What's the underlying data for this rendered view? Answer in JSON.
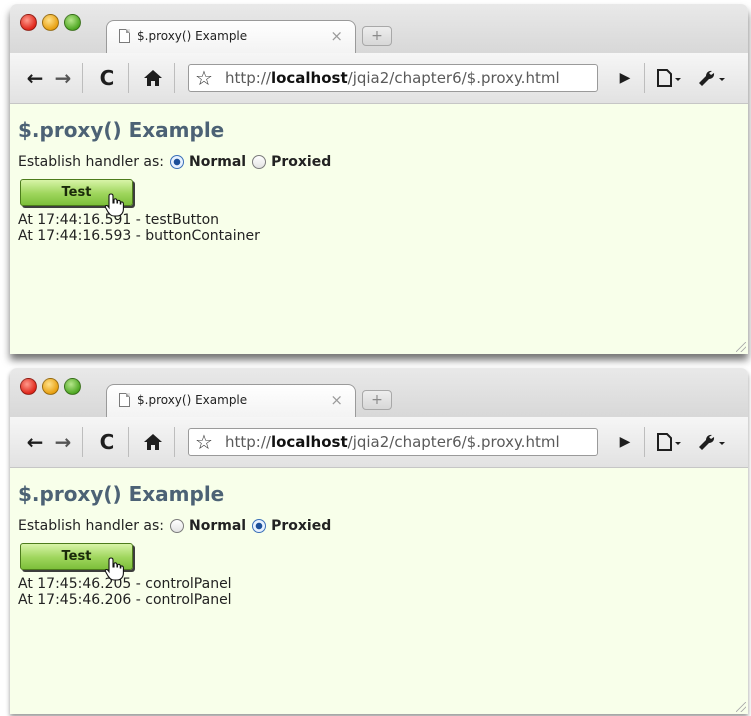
{
  "windows": [
    {
      "tab_title": "$.proxy() Example",
      "tab_close": "×",
      "url_prefix": "http://",
      "url_host": "localhost",
      "url_path": "/jqia2/chapter6/$.proxy.html",
      "heading": "$.proxy() Example",
      "handler_label": "Establish handler as:",
      "option_normal": "Normal",
      "option_proxied": "Proxied",
      "selected": "Normal",
      "button_label": "Test",
      "log": [
        "At 17:44:16.591 - testButton",
        "At 17:44:16.593 - buttonContainer"
      ]
    },
    {
      "tab_title": "$.proxy() Example",
      "tab_close": "×",
      "url_prefix": "http://",
      "url_host": "localhost",
      "url_path": "/jqia2/chapter6/$.proxy.html",
      "heading": "$.proxy() Example",
      "handler_label": "Establish handler as:",
      "option_normal": "Normal",
      "option_proxied": "Proxied",
      "selected": "Proxied",
      "button_label": "Test",
      "log": [
        "At 17:45:46.205 - controlPanel",
        "At 17:45:46.206 - controlPanel"
      ]
    }
  ],
  "icons": {
    "back": "back-arrow-icon",
    "forward": "forward-arrow-icon",
    "reload": "reload-icon",
    "home": "home-icon",
    "bookmark": "star-icon",
    "go": "play-icon",
    "page_menu": "page-menu-icon",
    "wrench_menu": "wrench-menu-icon",
    "cursor": "hand-cursor-icon"
  },
  "colors": {
    "page_bg": "#f8ffea",
    "heading": "#4c6275",
    "button_green": "#9ed55c",
    "radio_selected": "#1c4f99"
  }
}
